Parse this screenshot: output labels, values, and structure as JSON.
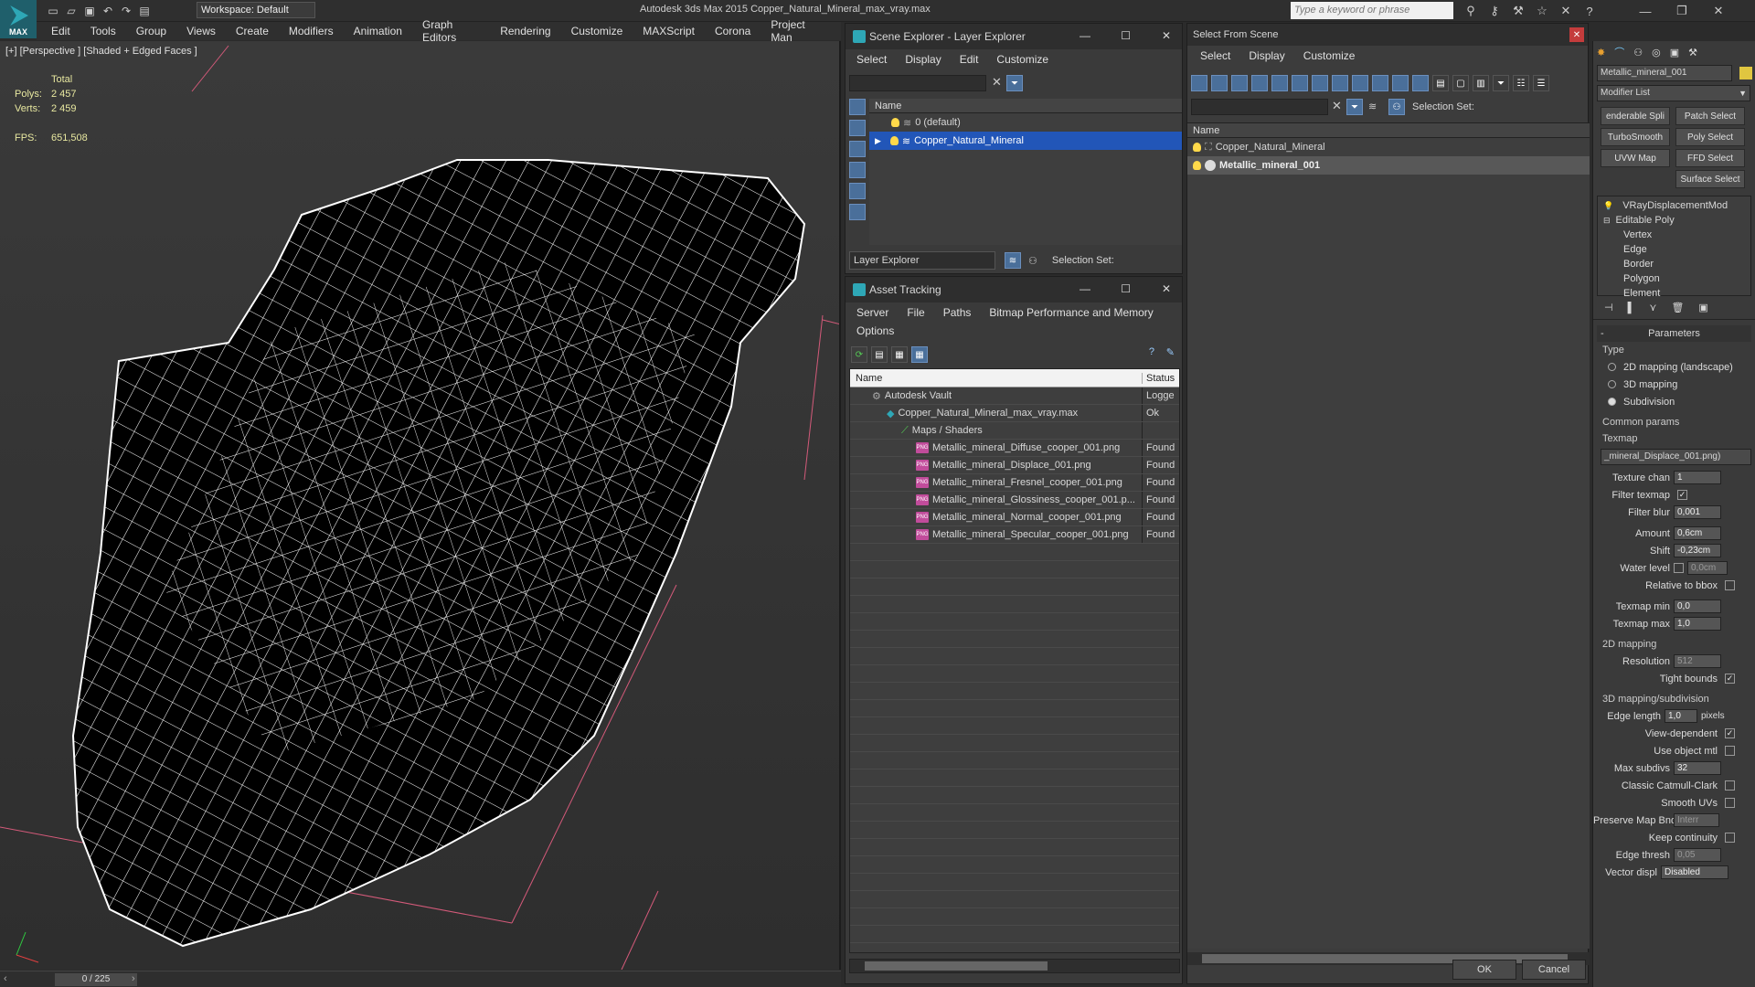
{
  "app": {
    "logo": "MAX",
    "workspace": "Workspace: Default",
    "title": "Autodesk 3ds Max  2015     Copper_Natural_Mineral_max_vray.max",
    "search_placeholder": "Type a keyword or phrase"
  },
  "menu": [
    "Edit",
    "Tools",
    "Group",
    "Views",
    "Create",
    "Modifiers",
    "Animation",
    "Graph Editors",
    "Rendering",
    "Customize",
    "MAXScript",
    "Corona",
    "Project Man"
  ],
  "viewport": {
    "label": "[+] [Perspective ] [Shaded + Edged Faces ]",
    "total_label": "Total",
    "polys_label": "Polys:",
    "polys": "2 457",
    "verts_label": "Verts:",
    "verts": "2 459",
    "fps_label": "FPS:",
    "fps": "651,508",
    "frame": "0 / 225"
  },
  "scene_explorer": {
    "title": "Scene Explorer - Layer Explorer",
    "menu": [
      "Select",
      "Display",
      "Edit",
      "Customize"
    ],
    "col": "Name",
    "rows": [
      "0 (default)",
      "Copper_Natural_Mineral"
    ],
    "footer_dropdown": "Layer Explorer",
    "selection_set": "Selection Set:"
  },
  "asset_tracking": {
    "title": "Asset Tracking",
    "menu": [
      "Server",
      "File",
      "Paths",
      "Bitmap Performance and Memory"
    ],
    "menu2": "Options",
    "col_name": "Name",
    "col_status": "Status",
    "rows": [
      {
        "name": "Autodesk Vault",
        "status": "Logge"
      },
      {
        "name": "Copper_Natural_Mineral_max_vray.max",
        "status": "Ok"
      },
      {
        "name": "Maps / Shaders",
        "status": ""
      },
      {
        "name": "Metallic_mineral_Diffuse_cooper_001.png",
        "status": "Found"
      },
      {
        "name": "Metallic_mineral_Displace_001.png",
        "status": "Found"
      },
      {
        "name": "Metallic_mineral_Fresnel_cooper_001.png",
        "status": "Found"
      },
      {
        "name": "Metallic_mineral_Glossiness_cooper_001.p...",
        "status": "Found"
      },
      {
        "name": "Metallic_mineral_Normal_cooper_001.png",
        "status": "Found"
      },
      {
        "name": "Metallic_mineral_Specular_cooper_001.png",
        "status": "Found"
      }
    ]
  },
  "select_scene": {
    "title": "Select From Scene",
    "menu": [
      "Select",
      "Display",
      "Customize"
    ],
    "selection_set": "Selection Set:",
    "col": "Name",
    "rows": [
      "Copper_Natural_Mineral",
      "Metallic_mineral_001"
    ],
    "ok": "OK",
    "cancel": "Cancel"
  },
  "command_panel": {
    "object_name": "Metallic_mineral_001",
    "modifier_list": "Modifier List",
    "buttons": [
      "enderable Spli",
      "Patch Select",
      "TurboSmooth",
      "Poly Select",
      "UVW Map",
      "FFD Select",
      "Surface Select"
    ],
    "stack": [
      "VRayDisplacementMod",
      "Editable Poly",
      "Vertex",
      "Edge",
      "Border",
      "Polygon",
      "Element"
    ],
    "parameters_title": "Parameters",
    "type_label": "Type",
    "types": [
      "2D mapping (landscape)",
      "3D mapping",
      "Subdivision"
    ],
    "common": "Common params",
    "texmap": "Texmap",
    "texmap_value": "_mineral_Displace_001.png)",
    "p_texture_chan": "Texture chan",
    "v_texture_chan": "1",
    "p_filter_texmap": "Filter texmap",
    "p_filter_blur": "Filter blur",
    "v_filter_blur": "0,001",
    "p_amount": "Amount",
    "v_amount": "0,6cm",
    "p_shift": "Shift",
    "v_shift": "-0,23cm",
    "p_water": "Water level",
    "v_water": "0,0cm",
    "p_relative": "Relative to bbox",
    "p_texmin": "Texmap min",
    "v_texmin": "0,0",
    "p_texmax": "Texmap max",
    "v_texmax": "1,0",
    "sec_2d": "2D mapping",
    "p_resolution": "Resolution",
    "v_resolution": "512",
    "p_tight": "Tight bounds",
    "sec_3d": "3D mapping/subdivision",
    "p_edge": "Edge length",
    "v_edge": "1,0",
    "u_edge": "pixels",
    "p_viewdep": "View-dependent",
    "p_objmtl": "Use object mtl",
    "p_maxsub": "Max subdivs",
    "v_maxsub": "32",
    "p_catmull": "Classic Catmull-Clark",
    "p_smooth": "Smooth UVs",
    "p_preserve": "Preserve Map Bnd",
    "v_preserve": "Interr",
    "p_keep": "Keep continuity",
    "p_thresh": "Edge thresh",
    "v_thresh": "0,05",
    "p_vector": "Vector displ",
    "v_vector": "Disabled"
  }
}
